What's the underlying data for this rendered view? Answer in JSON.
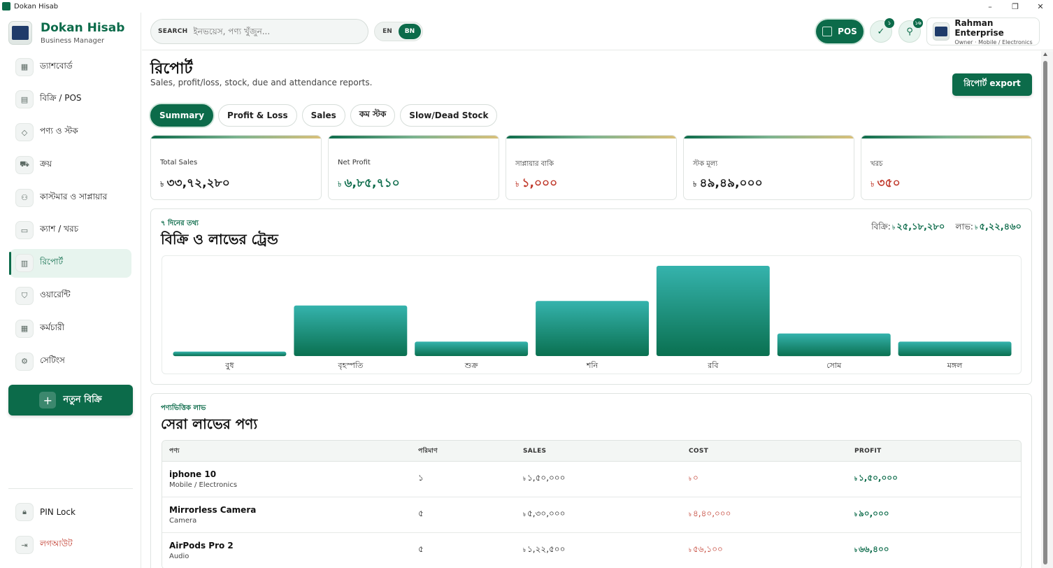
{
  "window": {
    "title": "Dokan Hisab"
  },
  "brand": {
    "title": "Dokan Hisab",
    "subtitle": "Business Manager"
  },
  "sidebar": {
    "items": [
      {
        "label": "ড্যাশবোর্ড",
        "icon": "grid-icon"
      },
      {
        "label": "বিক্রি / POS",
        "icon": "receipt-icon"
      },
      {
        "label": "পণ্য ও স্টক",
        "icon": "box-icon"
      },
      {
        "label": "ক্রয়",
        "icon": "truck-icon"
      },
      {
        "label": "কাস্টমার ও সাপ্লায়ার",
        "icon": "users-icon"
      },
      {
        "label": "ক্যাশ / খরচ",
        "icon": "wallet-icon"
      },
      {
        "label": "রিপোর্ট",
        "icon": "bar-chart-icon",
        "active": true
      },
      {
        "label": "ওয়ারেন্টি",
        "icon": "shield-icon"
      },
      {
        "label": "কর্মচারী",
        "icon": "calendar-icon"
      },
      {
        "label": "সেটিংস",
        "icon": "gear-icon"
      }
    ],
    "new_sale_label": "নতুন বিক্রি",
    "pin_lock_label": "PIN Lock",
    "logout_label": "লগআউট"
  },
  "header": {
    "search_label": "SEARCH",
    "search_placeholder": "ইনভয়েস, পণ্য খুঁজুন...",
    "lang_en": "EN",
    "lang_bn": "BN",
    "pos_label": "POS",
    "warranty_badge": "১",
    "tools_badge": "১৬",
    "profile_name": "Rahman Enterprise",
    "profile_role": "Owner · Mobile / Electronics"
  },
  "page": {
    "title": "রিপোর্ট",
    "subtitle": "Sales, profit/loss, stock, due and attendance reports.",
    "export_label": "রিপোর্ট export"
  },
  "tabs": [
    {
      "label": "Summary",
      "active": true
    },
    {
      "label": "Profit & Loss"
    },
    {
      "label": "Sales"
    },
    {
      "label": "কম স্টক"
    },
    {
      "label": "Slow/Dead Stock"
    }
  ],
  "currency": "৳",
  "kpis": [
    {
      "label": "Total Sales",
      "value": "৩৩,৭২,২৮০",
      "tone": "dark"
    },
    {
      "label": "Net Profit",
      "value": "৬,৮৫,৭১০",
      "tone": "green"
    },
    {
      "label": "সাপ্লায়ার বাকি",
      "value": "১,০০০",
      "tone": "red"
    },
    {
      "label": "স্টক মূল্য",
      "value": "৪৯,৪৯,০০০",
      "tone": "dark"
    },
    {
      "label": "খরচ",
      "value": "৩৫০",
      "tone": "red"
    }
  ],
  "trend": {
    "kicker": "৭ দিনের তথ্য",
    "title": "বিক্রি ও লাভের ট্রেন্ড",
    "sales_label": "বিক্রি:",
    "sales_value": "২৫,১৮,২৮০",
    "profit_label": "লাভ:",
    "profit_value": "৫,২২,৪৬০"
  },
  "chart_data": {
    "type": "bar",
    "categories": [
      "বুধ",
      "বৃহস্পতি",
      "শুক্র",
      "শনি",
      "রবি",
      "সোম",
      "মঙ্গল"
    ],
    "values": [
      5,
      56,
      16,
      61,
      100,
      25,
      16
    ],
    "ylim": [
      0,
      100
    ],
    "grid": false,
    "bar_color_top": "#35b3ad",
    "bar_color_bottom": "#0a7050"
  },
  "top_products": {
    "kicker": "পণ্যভিত্তিক লাভ",
    "title": "সেরা লাভের পণ্য",
    "columns": [
      "পণ্য",
      "পরিমাণ",
      "SALES",
      "COST",
      "PROFIT"
    ],
    "rows": [
      {
        "name": "iphone 10",
        "category": "Mobile / Electronics",
        "qty": "১",
        "sales": "১,৫০,০০০",
        "cost": "০",
        "profit": "১,৫০,০০০"
      },
      {
        "name": "Mirrorless Camera",
        "category": "Camera",
        "qty": "৫",
        "sales": "৫,৩০,০০০",
        "cost": "৪,৪০,০০০",
        "profit": "৯০,০০০"
      },
      {
        "name": "AirPods Pro 2",
        "category": "Audio",
        "qty": "৫",
        "sales": "১,২২,৫০০",
        "cost": "৫৬,১০০",
        "profit": "৬৬,৪০০"
      }
    ]
  }
}
